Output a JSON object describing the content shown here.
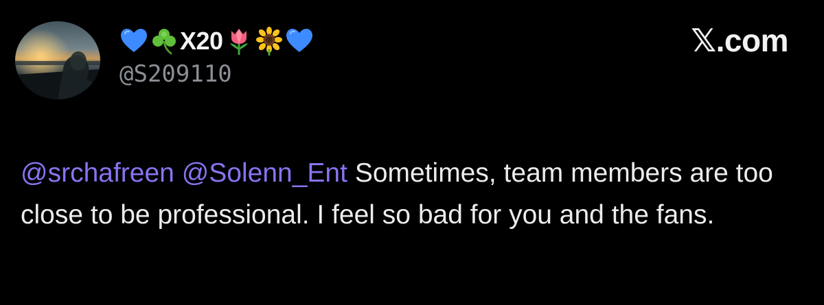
{
  "post": {
    "display_name_parts": [
      {
        "type": "emoji",
        "icon": "blue-heart-icon"
      },
      {
        "type": "emoji",
        "icon": "shamrock-icon"
      },
      {
        "type": "text",
        "text": "X20"
      },
      {
        "type": "emoji",
        "icon": "tulip-icon"
      },
      {
        "type": "emoji",
        "icon": "sunflower-icon"
      },
      {
        "type": "emoji",
        "icon": "blue-heart-icon"
      }
    ],
    "display_name_text": "X20",
    "handle": "@S209110",
    "brand": "𝕏.com",
    "mention_1": "@srchafreen",
    "mention_2": "@Solenn_Ent",
    "body_text": "Sometimes, team members are too close to be professional. I feel so bad for you and the fans."
  },
  "colors": {
    "background": "#000000",
    "text": "#ececec",
    "handle": "#8b9096",
    "mention": "#8a73f0",
    "blue_heart": "#3d8bff"
  }
}
